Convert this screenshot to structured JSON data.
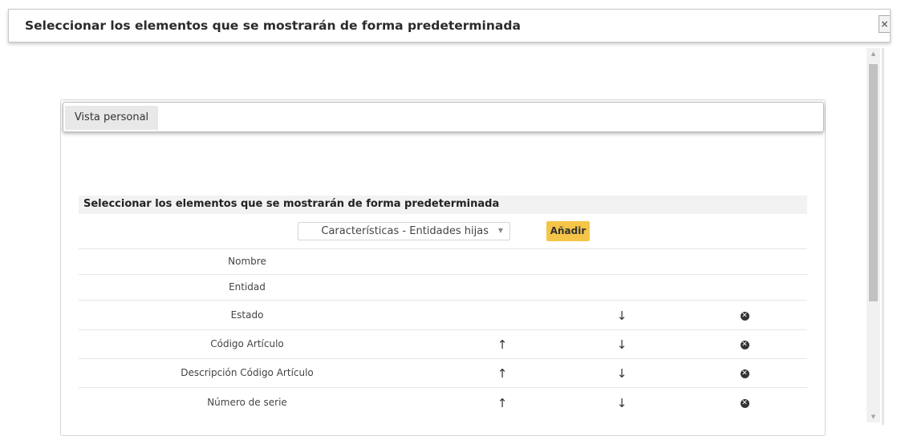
{
  "dialog": {
    "title": "Seleccionar los elementos que se mostrarán de forma predeterminada",
    "close_label": "×"
  },
  "tabs": [
    {
      "label": "Vista personal",
      "active": true
    }
  ],
  "section": {
    "title": "Seleccionar los elementos que se mostrarán de forma predeterminada",
    "select_value": "Características - Entidades hijas",
    "add_label": "Añadir"
  },
  "rows": [
    {
      "label": "Nombre",
      "up": false,
      "down": false,
      "remove": false
    },
    {
      "label": "Entidad",
      "up": false,
      "down": false,
      "remove": false
    },
    {
      "label": "Estado",
      "up": false,
      "down": true,
      "remove": true
    },
    {
      "label": "Código Artículo",
      "up": true,
      "down": true,
      "remove": true
    },
    {
      "label": "Descripción Código Artículo",
      "up": true,
      "down": true,
      "remove": true
    },
    {
      "label": "Número de serie",
      "up": true,
      "down": true,
      "remove": true
    }
  ],
  "icons": {
    "up": "arrow-up-icon",
    "down": "arrow-down-icon",
    "remove": "remove-circle-icon"
  },
  "colors": {
    "accent": "#f5c548",
    "section_bg": "#f2f2f2",
    "tab_bg": "#e8e8e8"
  }
}
